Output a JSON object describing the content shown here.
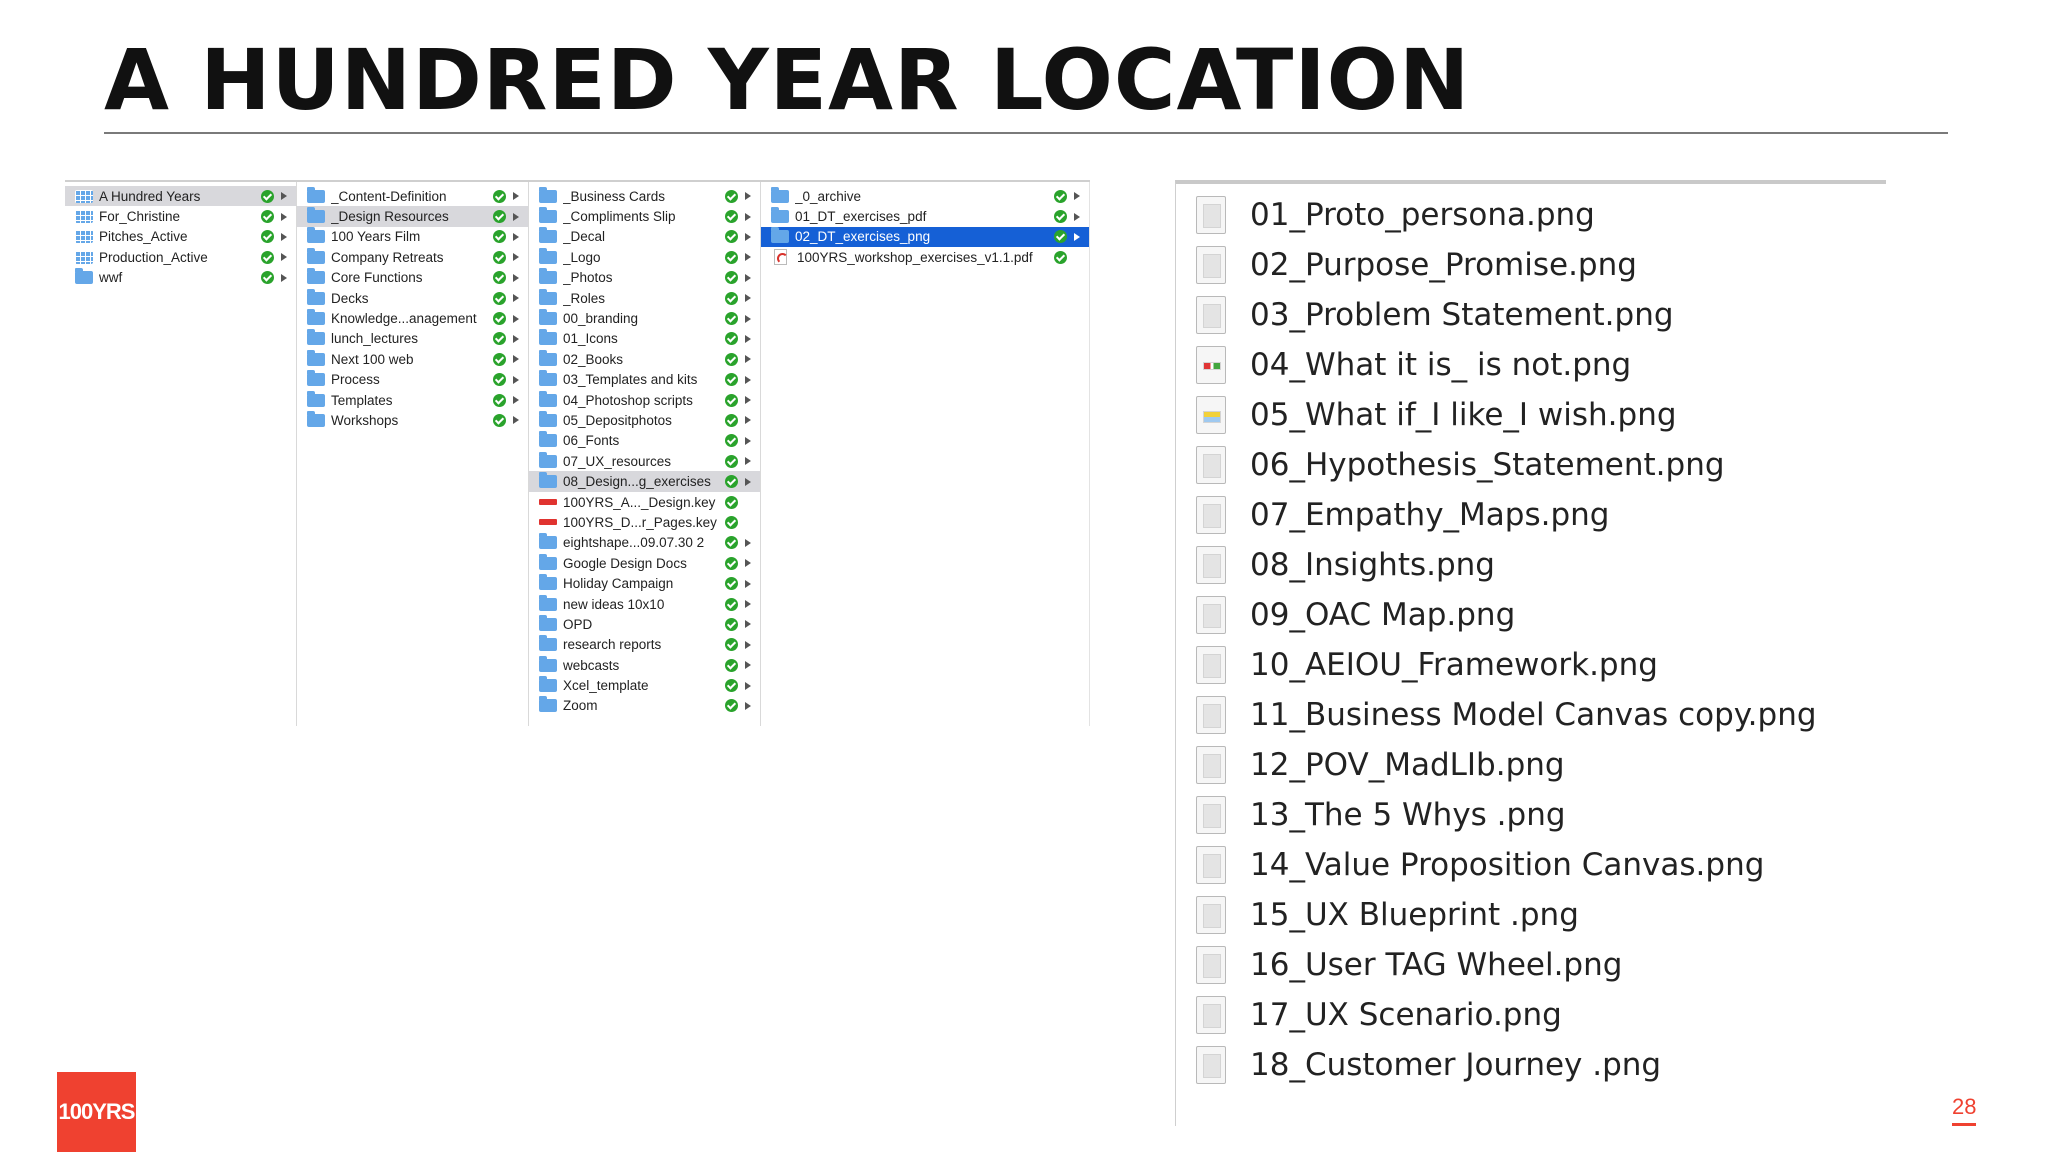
{
  "slide": {
    "title": "A HUNDRED YEAR LOCATION",
    "page_number": "28",
    "logo_text": "100YRS",
    "accent_color": "#ef4130"
  },
  "finder": {
    "columns": [
      {
        "items": [
          {
            "label": "A Hundred Years",
            "icon": "grid-folder",
            "status": "synced",
            "has_children": true,
            "selected": "grey"
          },
          {
            "label": "For_Christine",
            "icon": "grid-folder",
            "status": "synced",
            "has_children": true
          },
          {
            "label": "Pitches_Active",
            "icon": "grid-folder",
            "status": "synced",
            "has_children": true
          },
          {
            "label": "Production_Active",
            "icon": "grid-folder",
            "status": "synced",
            "has_children": true
          },
          {
            "label": "wwf",
            "icon": "folder",
            "status": "synced",
            "has_children": true
          }
        ]
      },
      {
        "items": [
          {
            "label": "_Content-Definition",
            "icon": "folder",
            "status": "synced",
            "has_children": true
          },
          {
            "label": "_Design Resources",
            "icon": "folder",
            "status": "synced",
            "has_children": true,
            "selected": "grey"
          },
          {
            "label": "100 Years Film",
            "icon": "folder",
            "status": "synced",
            "has_children": true
          },
          {
            "label": "Company Retreats",
            "icon": "folder",
            "status": "synced",
            "has_children": true
          },
          {
            "label": "Core Functions",
            "icon": "folder",
            "status": "synced",
            "has_children": true
          },
          {
            "label": "Decks",
            "icon": "folder",
            "status": "synced",
            "has_children": true
          },
          {
            "label": "Knowledge...anagement",
            "icon": "folder",
            "status": "synced",
            "has_children": true
          },
          {
            "label": "lunch_lectures",
            "icon": "folder",
            "status": "synced",
            "has_children": true
          },
          {
            "label": "Next 100 web",
            "icon": "folder",
            "status": "synced",
            "has_children": true
          },
          {
            "label": "Process",
            "icon": "folder",
            "status": "synced",
            "has_children": true
          },
          {
            "label": "Templates",
            "icon": "folder",
            "status": "synced",
            "has_children": true
          },
          {
            "label": "Workshops",
            "icon": "folder",
            "status": "synced",
            "has_children": true
          }
        ]
      },
      {
        "items": [
          {
            "label": "_Business Cards",
            "icon": "folder",
            "status": "synced",
            "has_children": true
          },
          {
            "label": "_Compliments Slip",
            "icon": "folder",
            "status": "synced",
            "has_children": true
          },
          {
            "label": "_Decal",
            "icon": "folder",
            "status": "synced",
            "has_children": true
          },
          {
            "label": "_Logo",
            "icon": "folder",
            "status": "synced",
            "has_children": true
          },
          {
            "label": "_Photos",
            "icon": "folder",
            "status": "synced",
            "has_children": true
          },
          {
            "label": "_Roles",
            "icon": "folder",
            "status": "synced",
            "has_children": true
          },
          {
            "label": "00_branding",
            "icon": "folder",
            "status": "synced",
            "has_children": true
          },
          {
            "label": "01_Icons",
            "icon": "folder",
            "status": "synced",
            "has_children": true
          },
          {
            "label": "02_Books",
            "icon": "folder",
            "status": "synced",
            "has_children": true
          },
          {
            "label": "03_Templates and kits",
            "icon": "folder",
            "status": "synced",
            "has_children": true
          },
          {
            "label": "04_Photoshop scripts",
            "icon": "folder",
            "status": "synced",
            "has_children": true
          },
          {
            "label": "05_Depositphotos",
            "icon": "folder",
            "status": "synced",
            "has_children": true
          },
          {
            "label": "06_Fonts",
            "icon": "folder",
            "status": "synced",
            "has_children": true
          },
          {
            "label": "07_UX_resources",
            "icon": "folder",
            "status": "synced",
            "has_children": true
          },
          {
            "label": "08_Design...g_exercises",
            "icon": "folder",
            "status": "synced",
            "has_children": true,
            "selected": "grey"
          },
          {
            "label": "100YRS_A..._Design.key",
            "icon": "keynote",
            "status": "synced",
            "has_children": false
          },
          {
            "label": "100YRS_D...r_Pages.key",
            "icon": "keynote",
            "status": "synced",
            "has_children": false
          },
          {
            "label": "eightshape...09.07.30 2",
            "icon": "folder",
            "status": "synced",
            "has_children": true
          },
          {
            "label": "Google Design Docs",
            "icon": "folder",
            "status": "synced",
            "has_children": true
          },
          {
            "label": "Holiday Campaign",
            "icon": "folder",
            "status": "synced",
            "has_children": true
          },
          {
            "label": "new ideas 10x10",
            "icon": "folder",
            "status": "synced",
            "has_children": true
          },
          {
            "label": "OPD",
            "icon": "folder",
            "status": "synced",
            "has_children": true
          },
          {
            "label": "research reports",
            "icon": "folder",
            "status": "synced",
            "has_children": true
          },
          {
            "label": "webcasts",
            "icon": "folder",
            "status": "synced",
            "has_children": true
          },
          {
            "label": "Xcel_template",
            "icon": "folder",
            "status": "synced",
            "has_children": true
          },
          {
            "label": "Zoom",
            "icon": "folder",
            "status": "synced",
            "has_children": true
          }
        ]
      },
      {
        "items": [
          {
            "label": "_0_archive",
            "icon": "folder",
            "status": "synced",
            "has_children": true
          },
          {
            "label": "01_DT_exercises_pdf",
            "icon": "folder",
            "status": "synced",
            "has_children": true
          },
          {
            "label": "02_DT_exercises_png",
            "icon": "folder",
            "status": "synced",
            "has_children": true,
            "selected": "blue"
          },
          {
            "label": "100YRS_workshop_exercises_v1.1.pdf",
            "icon": "pdf",
            "status": "synced",
            "has_children": false
          }
        ]
      }
    ]
  },
  "files": [
    {
      "name": "01_Proto_persona.png",
      "thumb": "plain"
    },
    {
      "name": "02_Purpose_Promise.png",
      "thumb": "plain"
    },
    {
      "name": "03_Problem Statement.png",
      "thumb": "plain"
    },
    {
      "name": "04_What it is_ is not.png",
      "thumb": "color-red"
    },
    {
      "name": "05_What if_I like_I wish.png",
      "thumb": "color-yellow"
    },
    {
      "name": "06_Hypothesis_Statement.png",
      "thumb": "plain"
    },
    {
      "name": "07_Empathy_Maps.png",
      "thumb": "plain"
    },
    {
      "name": "08_Insights.png",
      "thumb": "plain"
    },
    {
      "name": "09_OAC Map.png",
      "thumb": "plain"
    },
    {
      "name": "10_AEIOU_Framework.png",
      "thumb": "plain"
    },
    {
      "name": "11_Business Model Canvas copy.png",
      "thumb": "plain"
    },
    {
      "name": "12_POV_MadLIb.png",
      "thumb": "plain"
    },
    {
      "name": "13_The 5 Whys .png",
      "thumb": "plain"
    },
    {
      "name": "14_Value Proposition Canvas.png",
      "thumb": "plain"
    },
    {
      "name": "15_UX Blueprint .png",
      "thumb": "plain"
    },
    {
      "name": "16_User TAG Wheel.png",
      "thumb": "plain"
    },
    {
      "name": "17_UX Scenario.png",
      "thumb": "plain"
    },
    {
      "name": "18_Customer Journey .png",
      "thumb": "plain"
    }
  ]
}
